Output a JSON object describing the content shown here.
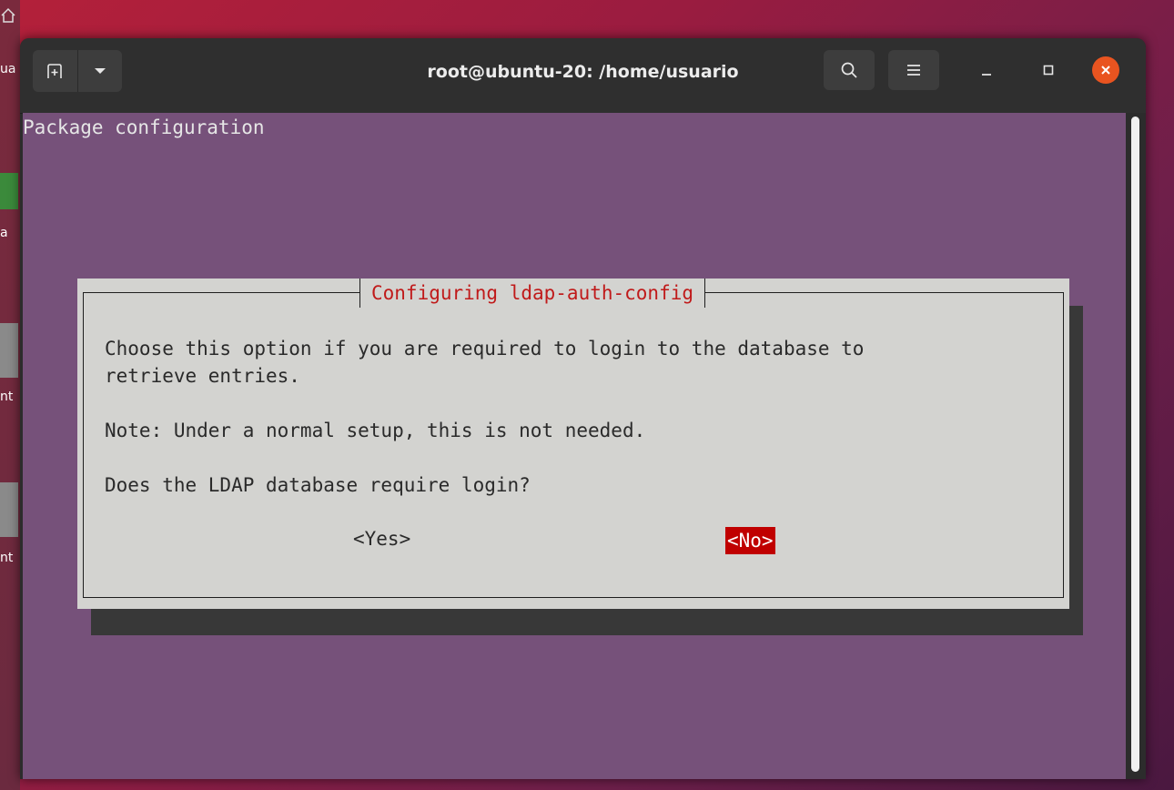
{
  "window": {
    "title": "root@ubuntu-20: /home/usuario",
    "icons": {
      "new_tab": "new-tab-icon",
      "dropdown": "chevron-down-icon",
      "search": "search-icon",
      "menu": "hamburger-menu-icon",
      "minimize": "minimize-icon",
      "maximize": "maximize-icon",
      "close": "close-icon"
    }
  },
  "terminal": {
    "header": "Package configuration",
    "background": "#76517a"
  },
  "dialog": {
    "title": "Configuring ldap-auth-config",
    "line1": "Choose this option if you are required to login to the database to",
    "line2": "retrieve entries.",
    "note": "Note: Under a normal setup, this is not needed.",
    "question": "Does the LDAP database require login?",
    "yes": "<Yes>",
    "no": "<No>",
    "accent": "#c00000"
  },
  "desktop": {
    "edge_labels": [
      "ua",
      "a",
      "nt",
      "nt"
    ]
  }
}
